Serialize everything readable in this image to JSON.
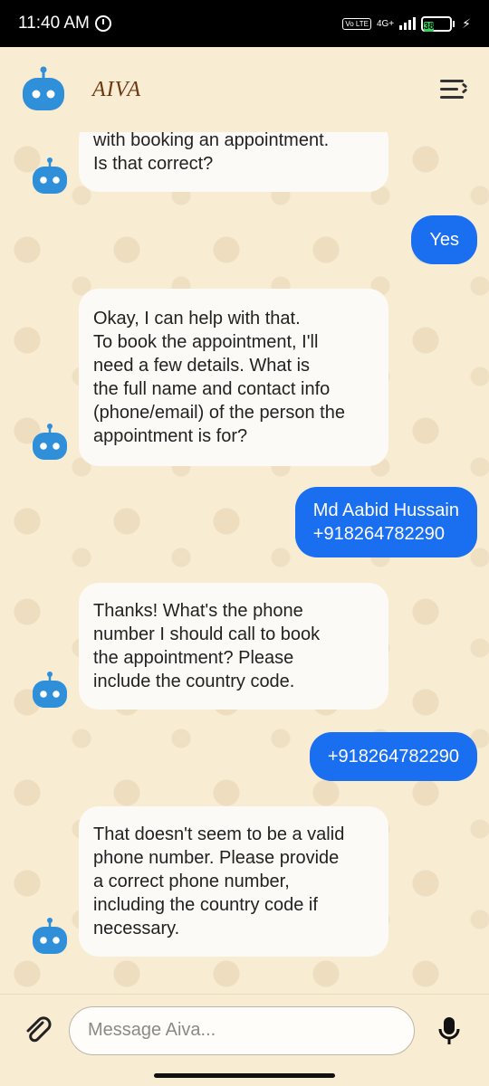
{
  "status": {
    "time": "11:40 AM",
    "network": "4G+",
    "volte": "Vo LTE",
    "battery": "38"
  },
  "header": {
    "brand": "AIVA"
  },
  "messages": [
    {
      "from": "bot",
      "text": "with booking an appointment.\nIs that correct?"
    },
    {
      "from": "user",
      "text": "Yes"
    },
    {
      "from": "bot",
      "text": "Okay, I can help with that.\nTo book the appointment, I'll\nneed a few details. What is\nthe full name and contact info\n(phone/email) of the person the\nappointment is for?"
    },
    {
      "from": "user",
      "text": "Md Aabid Hussain\n+918264782290"
    },
    {
      "from": "bot",
      "text": "Thanks! What's the phone\nnumber I should call to book\nthe appointment? Please\ninclude the country code."
    },
    {
      "from": "user",
      "text": "+918264782290"
    },
    {
      "from": "bot",
      "text": "That doesn't seem to be a valid\nphone number. Please provide\na correct phone number,\nincluding the country code if\nnecessary."
    }
  ],
  "input": {
    "placeholder": "Message Aiva..."
  },
  "colors": {
    "background": "#f8ecd3",
    "user_bubble": "#1a6ff1",
    "bot_bubble": "#fcfaf6",
    "bot_icon": "#2f8fd8"
  },
  "icons": {
    "header_logo": "robot-icon",
    "menu": "menu-icon",
    "attach": "paperclip-icon",
    "mic": "microphone-icon",
    "alarm": "alarm-icon"
  }
}
